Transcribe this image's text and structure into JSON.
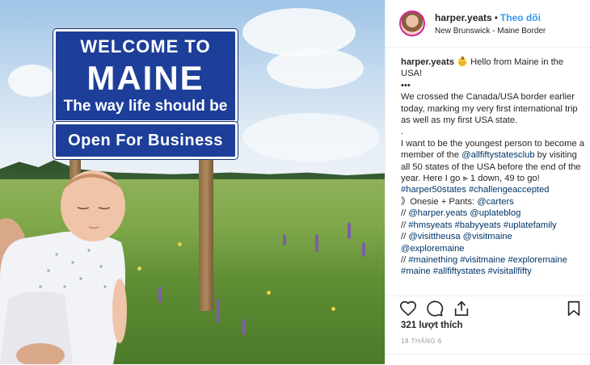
{
  "header": {
    "username": "harper.yeats",
    "follow_label": "Theo dõi",
    "location": "New Brunswick - Maine Border"
  },
  "photo": {
    "sign_line1": "WELCOME TO",
    "sign_line2": "MAINE",
    "sign_line3": "The way life should be",
    "sign_sub": "Open For Business"
  },
  "caption": {
    "username": "harper.yeats",
    "greeting": "👶 Hello from Maine in the USA!",
    "dots": "•••",
    "paragraph1": "We crossed the Canada/USA border earlier today, marking my very first international trip as well as my first USA state.",
    "period": ".",
    "paragraph2_pre": "I want to be the youngest person to become a member of the ",
    "paragraph2_link": "@allfiftystatesclub",
    "paragraph2_post": " by visiting all 50 states of the USA before the end of the year. Here I go ⪢ 1 down, 49 to go! ",
    "hashtags1": "#harper50states #challengeaccepted",
    "onesie": "》Onesie + Pants: ",
    "onesie_link": "@carters",
    "line_a_pre": "// ",
    "line_a": "@harper.yeats @uplateblog",
    "line_b": "#hmsyeats #babyyeats #uplatefamily",
    "line_c": "@visittheusa @visitmaine",
    "line_d": "@exploremaine",
    "line_e": "#mainething #visitmaine #exploremaine",
    "line_f": "#maine #allfiftystates #visitallfifty"
  },
  "actions": {
    "icons": [
      "heart-icon",
      "comment-icon",
      "share-icon",
      "bookmark-icon"
    ]
  },
  "likes": "321 lượt thích",
  "date": "18 THÁNG 6",
  "colors": {
    "link": "#003569",
    "follow": "#3897f0",
    "sign_blue": "#1d3f9a"
  }
}
